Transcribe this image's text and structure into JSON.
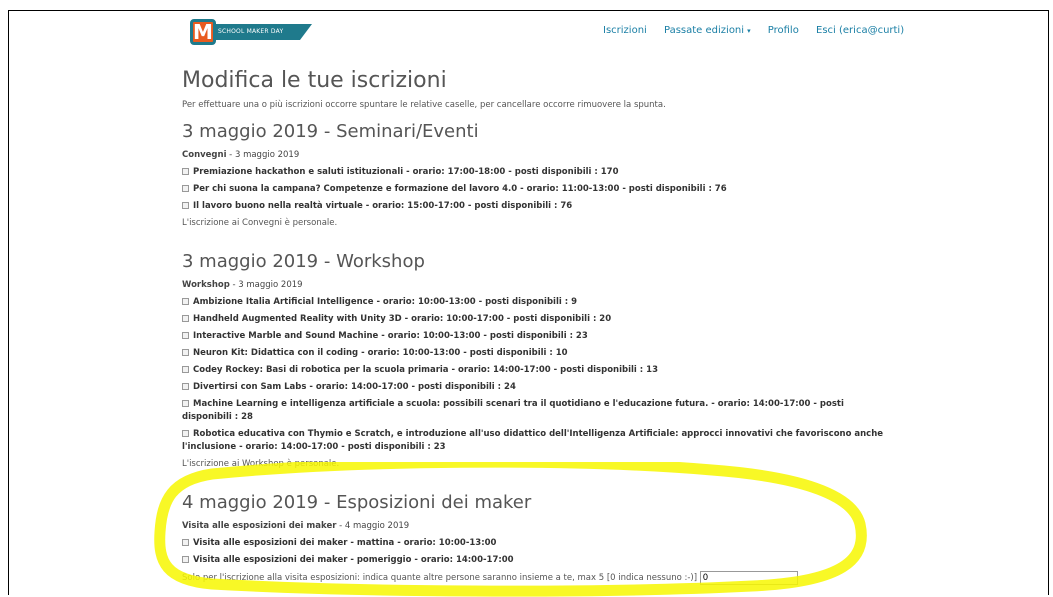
{
  "logo": {
    "letter": "M",
    "text": "SCHOOL MAKER DAY"
  },
  "nav": {
    "iscrizioni": "Iscrizioni",
    "passate": "Passate edizioni",
    "caret": "▾",
    "profilo": "Profilo",
    "esci": "Esci (erica@curti)"
  },
  "page": {
    "title": "Modifica le tue iscrizioni",
    "intro": "Per effettuare una o più iscrizioni occorre spuntare le relative caselle, per cancellare occorre rimuovere la spunta."
  },
  "sections": [
    {
      "heading": "3 maggio 2019 - Seminari/Eventi",
      "group": "Convegni",
      "group_date": " - 3 maggio 2019",
      "options": [
        "Premiazione hackathon e saluti istituzionali - orario: 17:00-18:00 - posti disponibili : 170",
        "Per chi suona la campana? Competenze e formazione del lavoro 4.0 - orario: 11:00-13:00 - posti disponibili : 76",
        "Il lavoro buono nella realtà virtuale - orario: 15:00-17:00 - posti disponibili : 76"
      ],
      "note": "L'iscrizione ai Convegni è personale."
    },
    {
      "heading": "3 maggio 2019 - Workshop",
      "group": "Workshop",
      "group_date": " - 3 maggio 2019",
      "options": [
        "Ambizione Italia Artificial Intelligence - orario: 10:00-13:00 - posti disponibili : 9",
        "Handheld Augmented Reality with Unity 3D - orario: 10:00-17:00 - posti disponibili : 20",
        "Interactive Marble and Sound Machine - orario: 10:00-13:00 - posti disponibili : 23",
        "Neuron Kit: Didattica con il coding - orario: 10:00-13:00 - posti disponibili : 10",
        "Codey Rockey: Basi di robotica per la scuola primaria - orario: 14:00-17:00 - posti disponibili : 13",
        "Divertirsi con Sam Labs - orario: 14:00-17:00 - posti disponibili : 24",
        "Machine Learning e intelligenza artificiale a scuola: possibili scenari tra il quotidiano e l'educazione futura. - orario: 14:00-17:00 - posti disponibili : 28",
        "Robotica educativa con Thymio e Scratch, e introduzione all'uso didattico dell'Intelligenza Artificiale: approcci innovativi che favoriscono anche l'inclusione - orario: 14:00-17:00 - posti disponibili : 23"
      ],
      "note": "L'iscrizione ai Workshop è personale."
    },
    {
      "heading": "4 maggio 2019 - Esposizioni dei maker",
      "group": "Visita alle esposizioni dei maker",
      "group_date": " - 4 maggio 2019",
      "options": [
        "Visita alle esposizioni dei maker - mattina - orario: 10:00-13:00",
        "Visita alle esposizioni dei maker - pomeriggio - orario: 14:00-17:00"
      ]
    }
  ],
  "visitors": {
    "label": "Solo per l'iscrizione alla visita esposizioni: indica quante altre persone saranno insieme a te, max 5 [0 indica nessuno :-)]",
    "value": "0"
  },
  "colors": {
    "link": "#1a7fa5",
    "logo_orange": "#e85b1f",
    "logo_teal": "#1f7a8c",
    "highlight": "#f7f700"
  }
}
